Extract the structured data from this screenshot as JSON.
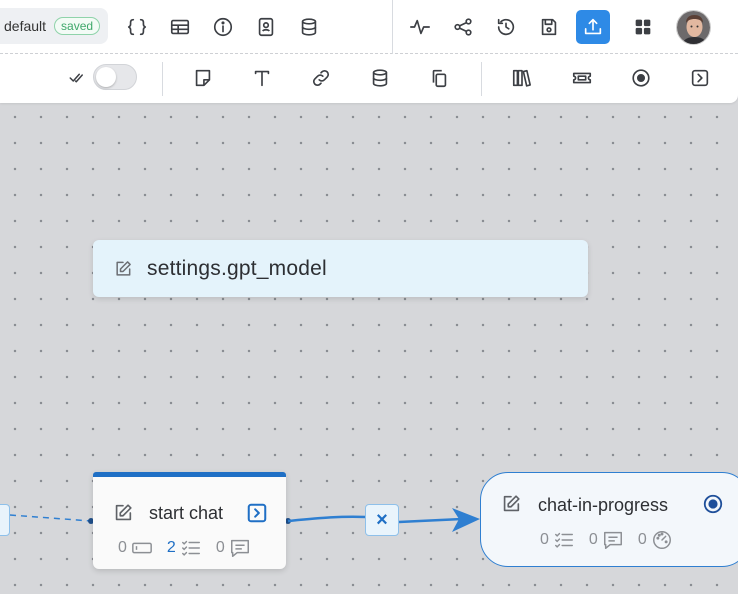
{
  "project": {
    "name": "default",
    "status": "saved"
  },
  "topbar_icons": [
    "braces-icon",
    "table-icon",
    "info-icon",
    "contact-card-icon",
    "database-icon",
    "pulse-icon",
    "share-icon",
    "history-icon",
    "save-icon",
    "publish-icon",
    "apps-grid-icon",
    "user-avatar"
  ],
  "toolbar_icons": [
    "check-all-icon",
    "toggle",
    "sticky-note-icon",
    "text-icon",
    "link-icon",
    "database-icon",
    "copy-icon",
    "library-icon",
    "ticket-icon",
    "radio-target-icon",
    "chevron-right-box-icon"
  ],
  "toggle": {
    "on": false
  },
  "canvas": {
    "variable_node": {
      "label": "settings.gpt_model"
    },
    "start_node": {
      "title": "start chat",
      "counters": {
        "inputs": "0",
        "conditions": "2",
        "messages": "0"
      }
    },
    "progress_node": {
      "title": "chat-in-progress",
      "counters": {
        "conditions": "0",
        "messages": "0",
        "settings": "0"
      }
    },
    "delete_connection": "×"
  },
  "colors": {
    "accent": "#2e8ae6",
    "node_border": "#1f6fc5",
    "variable_bg": "#e4f3fb",
    "saved": "#3fa86b"
  }
}
